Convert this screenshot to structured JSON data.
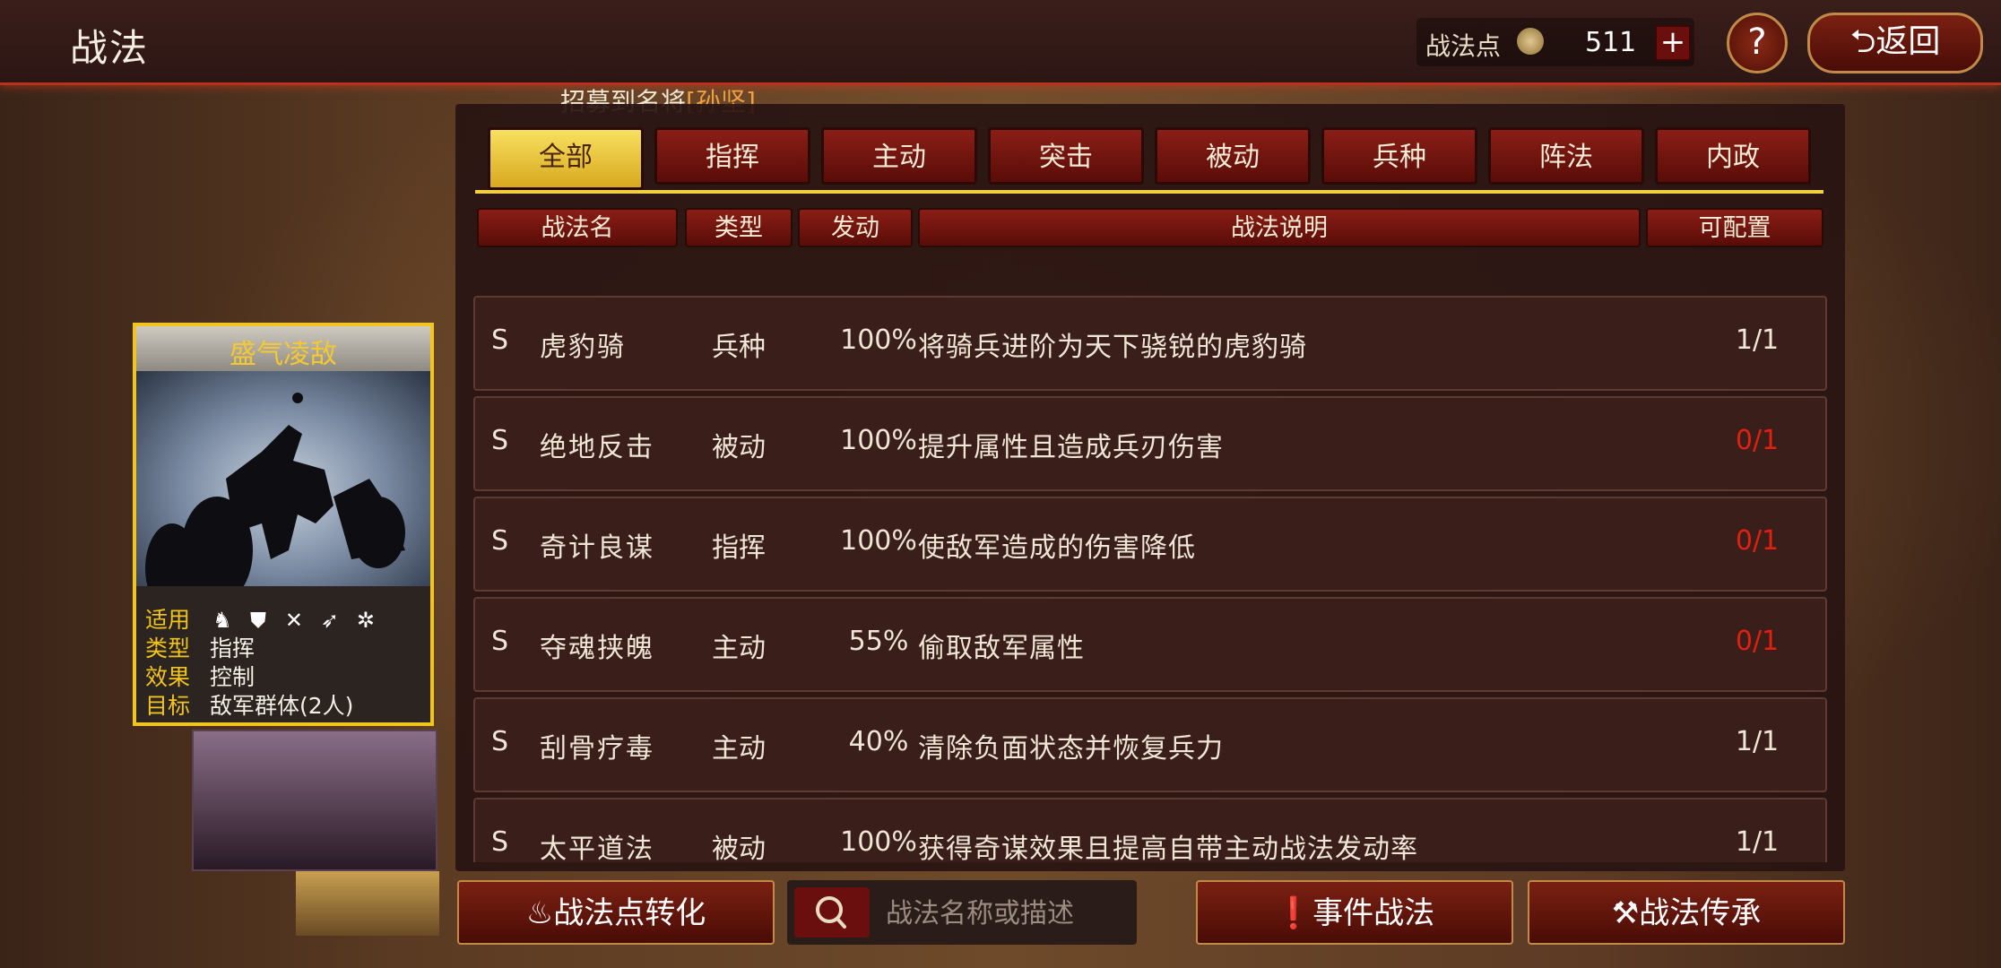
{
  "header": {
    "title": "战法",
    "points_label": "战法点",
    "points_value": "511",
    "plus": "+",
    "help": "?",
    "back": "返回"
  },
  "notice": {
    "prefix": "招募到名将",
    "general": "[孙坚]"
  },
  "tabs": [
    "全部",
    "指挥",
    "主动",
    "突击",
    "被动",
    "兵种",
    "阵法",
    "内政"
  ],
  "active_tab": "全部",
  "columns": [
    "战法名",
    "类型",
    "发动",
    "战法说明",
    "可配置"
  ],
  "rows": [
    {
      "grade": "S",
      "name": "虎豹骑",
      "type": "兵种",
      "rate": "100%",
      "desc_parts": [
        "将",
        "骑兵",
        "进阶为天下骁锐的",
        "虎豹骑"
      ],
      "config": "1/1",
      "config_red": false
    },
    {
      "grade": "S",
      "name": "绝地反击",
      "type": "被动",
      "rate": "100%",
      "desc": "提升属性且造成兵刃伤害",
      "config": "0/1",
      "config_red": true
    },
    {
      "grade": "S",
      "name": "奇计良谋",
      "type": "指挥",
      "rate": "100%",
      "desc": "使敌军造成的伤害降低",
      "config": "0/1",
      "config_red": true
    },
    {
      "grade": "S",
      "name": "夺魂挟魄",
      "type": "主动",
      "rate": "55%",
      "desc": "偷取敌军属性",
      "config": "0/1",
      "config_red": true
    },
    {
      "grade": "S",
      "name": "刮骨疗毒",
      "type": "主动",
      "rate": "40%",
      "desc": "清除负面状态并恢复兵力",
      "config": "1/1",
      "config_red": false
    },
    {
      "grade": "S",
      "name": "太平道法",
      "type": "被动",
      "rate": "100%",
      "desc": "获得奇谋效果且提高自带主动战法发动率",
      "config": "1/1",
      "config_red": false
    }
  ],
  "card": {
    "title": "盛气凌敌",
    "apply_label": "适用",
    "type_label": "类型",
    "type_value": "指挥",
    "effect_label": "效果",
    "effect_value": "控制",
    "target_label": "目标",
    "target_value": "敌军群体(2人)"
  },
  "bottom": {
    "convert": "战法点转化",
    "search_placeholder": "战法名称或描述",
    "event": "事件战法",
    "inherit": "战法传承"
  },
  "colors": {
    "accent_red": "#e02010",
    "highlight": "#f0a040",
    "active_tab": "#f2d040"
  }
}
